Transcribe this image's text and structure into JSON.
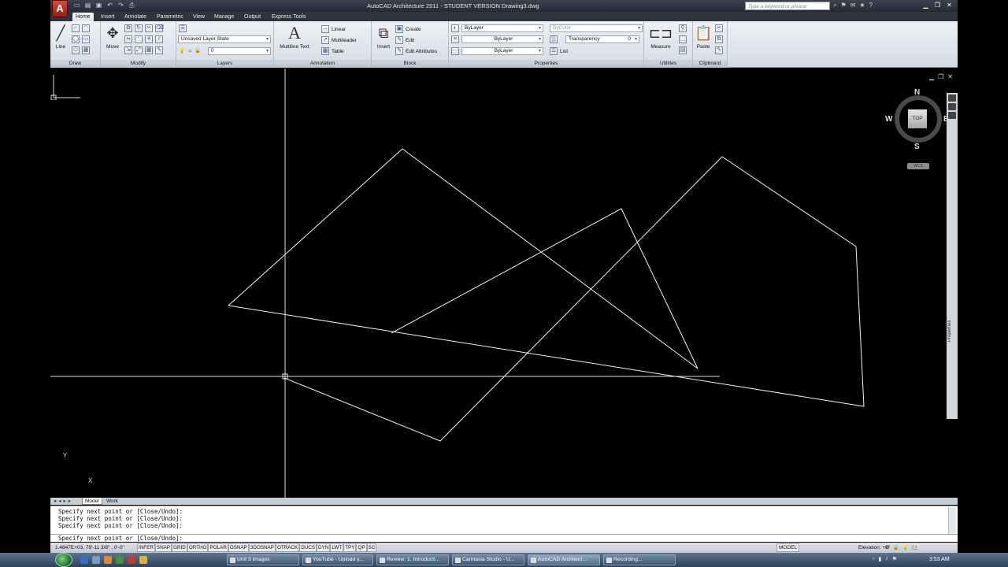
{
  "titlebar": {
    "logo": "A",
    "title": "AutoCAD Architecture 2011 - STUDENT VERSION    Drawing3.dwg",
    "search_placeholder": "Type a keyword or phrase"
  },
  "tabs": [
    "Home",
    "Insert",
    "Annotate",
    "Parametric",
    "View",
    "Manage",
    "Output",
    "Express Tools"
  ],
  "ribbon": {
    "draw": {
      "title": "Draw",
      "line_label": "Line"
    },
    "modify": {
      "title": "Modify",
      "move_label": "Move"
    },
    "layers": {
      "title": "Layers",
      "layer_state": "Unsaved Layer State",
      "current_layer": "0"
    },
    "annotation": {
      "title": "Annotation",
      "multiline_text": "Multiline Text",
      "linear": "Linear",
      "multileader": "Multileader",
      "table": "Table"
    },
    "block": {
      "title": "Block",
      "insert": "Insert",
      "create": "Create",
      "edit": "Edit",
      "edit_attributes": "Edit Attributes"
    },
    "properties": {
      "title": "Properties",
      "color": "ByLayer",
      "bycolor": "ByColor",
      "linetype": "ByLayer",
      "lineweight": "ByLayer",
      "transparency": "Transparency",
      "transparency_value": "0",
      "list": "List"
    },
    "utilities": {
      "title": "Utilities",
      "measure": "Measure"
    },
    "clipboard": {
      "title": "Clipboard",
      "paste": "Paste"
    }
  },
  "viewcube": {
    "north": "N",
    "south": "S",
    "west": "W",
    "east": "E",
    "face": "TOP",
    "wcs": "WCS"
  },
  "side_panel": {
    "properties": "Properties"
  },
  "ucs": {
    "x": "X",
    "y": "Y"
  },
  "layout_tabs": [
    "Model",
    "Work"
  ],
  "command_line": {
    "history": [
      "Specify next point or [Close/Undo]:",
      "Specify next point or [Close/Undo]:",
      "Specify next point or [Close/Undo]:"
    ],
    "prompt": "Specify next point or [Close/Undo]:"
  },
  "status_bar": {
    "coordinates": "1.4847E+03, 79'-11 3/8\" , 0'-0\"",
    "toggles": [
      "INFER",
      "SNAP",
      "GRID",
      "ORTHO",
      "POLAR",
      "OSNAP",
      "3DOSNAP",
      "OTRACK",
      "DUCS",
      "DYN",
      "LWT",
      "TPY",
      "QP",
      "SC"
    ],
    "model": "MODEL",
    "elevation": "Elevation: +0\""
  },
  "taskbar": {
    "tasks": [
      "Unit 3 images",
      "YouTube - Upload y...",
      "Review: 1. Introducti...",
      "Camtasia Studio - U...",
      "AutoCAD Architect...",
      "Recording..."
    ],
    "clock": "3:53 AM"
  }
}
